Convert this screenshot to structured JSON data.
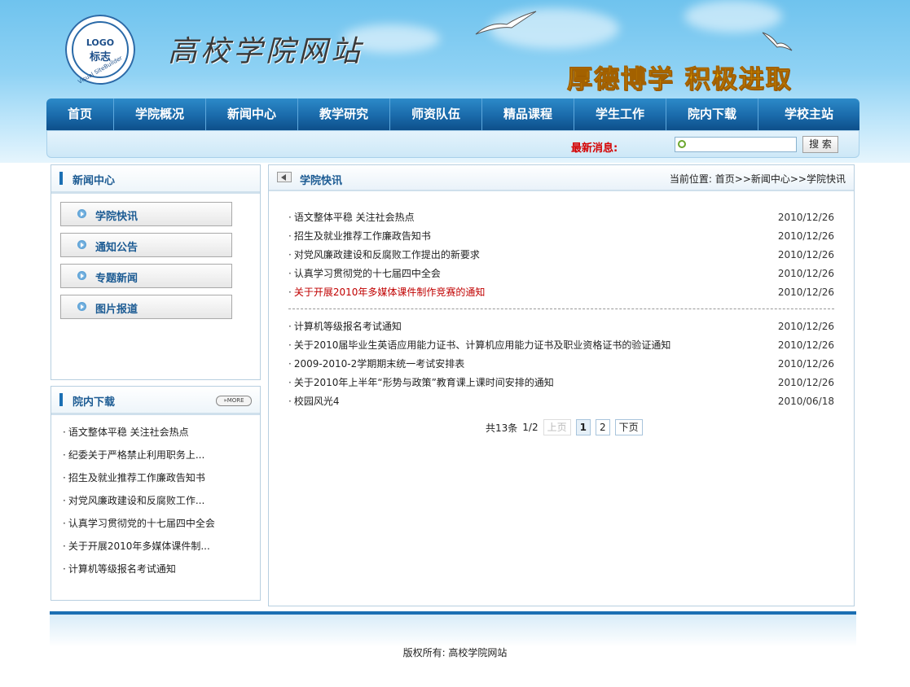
{
  "header": {
    "logo_text": "LOGO",
    "logo_cn": "标志",
    "logo_ring": "Visual SiteBuilder",
    "site_title": "高校学院网站",
    "slogan": "厚德博学  积极进取"
  },
  "nav": {
    "items": [
      "首页",
      "学院概况",
      "新闻中心",
      "教学研究",
      "师资队伍",
      "精品课程",
      "学生工作",
      "院内下载",
      "学校主站"
    ]
  },
  "subbar": {
    "latest_label": "最新消息:",
    "search_placeholder": "",
    "search_button": "搜 索"
  },
  "sidebar": {
    "news_title": "新闻中心",
    "menu": [
      "学院快讯",
      "通知公告",
      "专题新闻",
      "图片报道"
    ],
    "download_title": "院内下载",
    "more_label": "MORE",
    "downloads": [
      "语文整体平稳 关注社会热点",
      "纪委关于严格禁止利用职务上...",
      "招生及就业推荐工作廉政告知书",
      "对党风廉政建设和反腐败工作...",
      "认真学习贯彻党的十七届四中全会",
      "关于开展2010年多媒体课件制...",
      "计算机等级报名考试通知"
    ]
  },
  "main": {
    "title": "学院快讯",
    "location_label": "当前位置:",
    "location_path": "首页>>新闻中心>>学院快讯",
    "news_group1": [
      {
        "title": "语文整体平稳 关注社会热点",
        "date": "2010/12/26"
      },
      {
        "title": "招生及就业推荐工作廉政告知书",
        "date": "2010/12/26"
      },
      {
        "title": "对党风廉政建设和反腐败工作提出的新要求",
        "date": "2010/12/26"
      },
      {
        "title": "认真学习贯彻党的十七届四中全会",
        "date": "2010/12/26"
      },
      {
        "title": "关于开展2010年多媒体课件制作竞赛的通知",
        "date": "2010/12/26"
      }
    ],
    "news_group2": [
      {
        "title": "计算机等级报名考试通知",
        "date": "2010/12/26"
      },
      {
        "title": "关于2010届毕业生英语应用能力证书、计算机应用能力证书及职业资格证书的验证通知",
        "date": "2010/12/26"
      },
      {
        "title": "2009-2010-2学期期末统一考试安排表",
        "date": "2010/12/26"
      },
      {
        "title": "关于2010年上半年“形势与政策”教育课上课时间安排的通知",
        "date": "2010/12/26"
      },
      {
        "title": "校园风光4",
        "date": "2010/06/18"
      }
    ],
    "pager": {
      "total": "共13条",
      "page_info": "1/2",
      "prev": "上页",
      "pages": [
        "1",
        "2"
      ],
      "next": "下页"
    }
  },
  "footer": {
    "copyright": "版权所有: 高校学院网站"
  },
  "colors": {
    "brand_blue": "#1b6fb3",
    "highlight_red": "#c00000",
    "slogan_gold": "#f5b800"
  }
}
